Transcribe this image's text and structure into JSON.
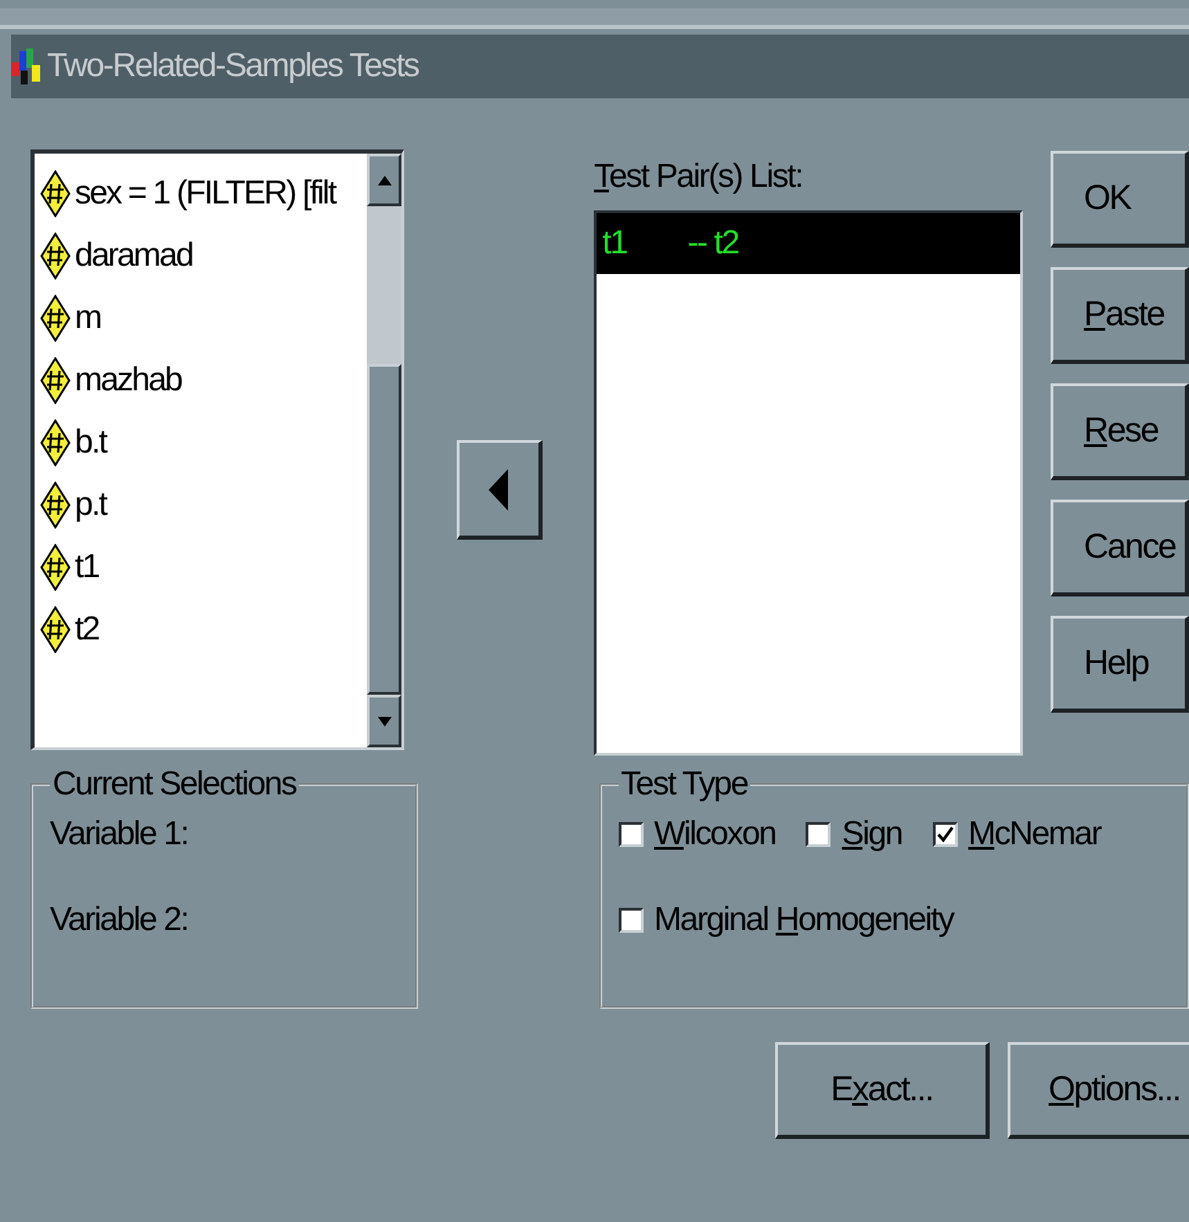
{
  "window": {
    "title": "Two-Related-Samples Tests"
  },
  "variables": [
    {
      "label": "sex = 1 (FILTER) [filt"
    },
    {
      "label": "daramad"
    },
    {
      "label": "m"
    },
    {
      "label": "mazhab"
    },
    {
      "label": "b.t"
    },
    {
      "label": "p.t"
    },
    {
      "label": "t1"
    },
    {
      "label": "t2"
    }
  ],
  "pair_list": {
    "label": {
      "key": "T",
      "post": "est Pair(s) List:"
    },
    "pairs": [
      {
        "first": "t1",
        "second": "-- t2",
        "selected": true
      }
    ]
  },
  "buttons": [
    {
      "pre": "OK"
    },
    {
      "key": "P",
      "post": "aste"
    },
    {
      "key": "R",
      "post": "ese"
    },
    {
      "pre": "Cance"
    },
    {
      "pre": "Help"
    }
  ],
  "current_selections": {
    "title": "Current Selections",
    "rows": [
      {
        "label": "Variable 1:"
      },
      {
        "label": "Variable 2:"
      }
    ]
  },
  "test_type": {
    "title": "Test Type",
    "options": [
      {
        "key": "W",
        "post": "ilcoxon",
        "checked": false
      },
      {
        "key": "S",
        "post": "ign",
        "checked": false
      },
      {
        "key": "M",
        "post": "cNemar",
        "checked": true
      },
      {
        "pre": "Marginal ",
        "key": "H",
        "post": "omogeneity",
        "checked": false
      }
    ]
  },
  "bottom_buttons": [
    {
      "pre": "E",
      "key": "x",
      "post": "act..."
    },
    {
      "key": "O",
      "post": "ptions..."
    }
  ]
}
